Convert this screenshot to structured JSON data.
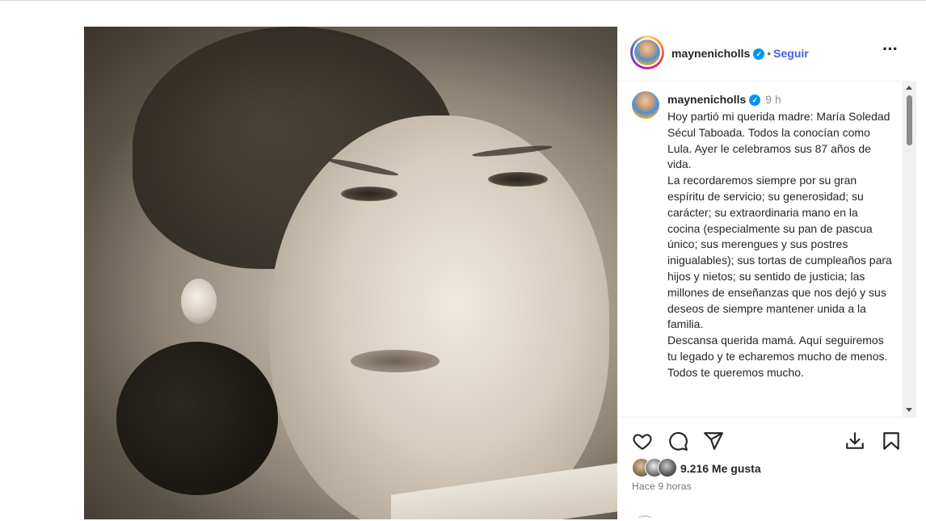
{
  "post": {
    "username": "maynenicholls",
    "follow_label": "Seguir",
    "dot": "•",
    "verified_icon": "verified-badge-icon",
    "more_icon": "more-options-icon",
    "caption_time": "9 h",
    "caption_text": "Hoy partió mi querida madre: María Soledad Sécul Taboada. Todos la conocían como Lula. Ayer le celebramos sus 87 años de vida.\nLa recordaremos siempre por su gran espíritu de servicio; su generosidad; su carácter; su extraordinaria mano en la cocina (especialmente su pan de pascua único; sus merengues y sus postres inigualables); sus tortas de cumpleaños para hijos y nietos; su sentido de justicia; las millones de enseñanzas que nos dejó y sus deseos de siempre mantener unida a la familia.\nDescansa querida mamá. Aquí seguiremos tu legado y te echaremos mucho de menos. Todos te queremos mucho.",
    "likes": "9.216 Me gusta",
    "time_ago": "Hace 9 horas"
  },
  "actions": {
    "like_icon": "heart-icon",
    "comment_icon": "comment-icon",
    "share_icon": "send-icon",
    "download_icon": "download-icon",
    "save_icon": "bookmark-icon"
  },
  "colors": {
    "verified": "#0095f6",
    "follow": "#4a5ce8",
    "text": "#262626",
    "muted": "#737373"
  }
}
